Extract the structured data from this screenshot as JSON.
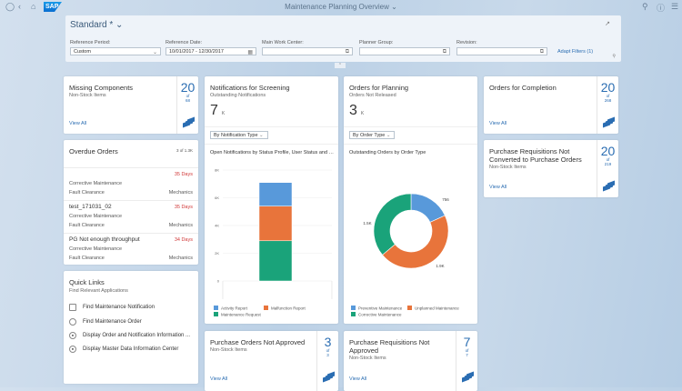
{
  "shell": {
    "title": "Maintenance Planning Overview",
    "logo": "SAP",
    "icons": [
      "user-icon",
      "back-icon",
      "home-icon",
      "search-icon",
      "help-icon",
      "menu-icon"
    ]
  },
  "filter": {
    "variant": "Standard *",
    "fields": [
      {
        "label": "Reference Period:",
        "value": "Custom"
      },
      {
        "label": "Reference Date:",
        "value": "10/01/2017 - 12/30/2017"
      },
      {
        "label": "Main Work Center:",
        "value": ""
      },
      {
        "label": "Planner Group:",
        "value": ""
      },
      {
        "label": "Revision:",
        "value": ""
      }
    ],
    "adapt": "Adapt Filters (1)"
  },
  "cards": {
    "missing": {
      "title": "Missing Components",
      "sub": "Non-Stock Items",
      "count": "20",
      "of": "of",
      "total": "68",
      "link": "View All"
    },
    "overdue": {
      "title": "Overdue Orders",
      "counter": "3 of 1.3K",
      "rows": [
        {
          "title": "",
          "days": "35 Days",
          "type": "Corrective Maintenance",
          "activity": "Fault Clearance",
          "group": "Mechanics"
        },
        {
          "title": "test_171031_02",
          "days": "35 Days",
          "type": "Corrective Maintenance",
          "activity": "Fault Clearance",
          "group": "Mechanics"
        },
        {
          "title": "PG Not enough throughput",
          "days": "34 Days",
          "type": "Corrective Maintenance",
          "activity": "Fault Clearance",
          "group": "Mechanics"
        }
      ]
    },
    "quick": {
      "title": "Quick Links",
      "sub": "Find Relevant Applications",
      "links": [
        "Find Maintenance Notification",
        "Find Maintenance Order",
        "Display Order and Notification Information ...",
        "Display Master Data Information Center"
      ]
    },
    "screening": {
      "title": "Notifications for Screening",
      "sub": "Outstanding Notifications",
      "kpi": "7",
      "unit": "K",
      "select": "By Notification Type",
      "chart_title": "Open Notifications by Status Profile, User Status and No..."
    },
    "planning": {
      "title": "Orders for Planning",
      "sub": "Orders Not Released",
      "kpi": "3",
      "unit": "K",
      "select": "By Order Type",
      "chart_title": "Outstanding Orders by Order Type"
    },
    "completion": {
      "title": "Orders for Completion",
      "count": "20",
      "of": "of",
      "total": "268",
      "link": "View All"
    },
    "prnc": {
      "title": "Purchase Requisitions Not Converted to Purchase Orders",
      "sub": "Non-Stock Items",
      "count": "20",
      "of": "of",
      "total": "219",
      "link": "View All"
    },
    "pona": {
      "title": "Purchase Orders Not Approved",
      "sub": "Non-Stock Items",
      "count": "3",
      "of": "of",
      "total": "3",
      "link": "View All"
    },
    "prna": {
      "title": "Purchase Requisitions Not Approved",
      "sub": "Non-Stock Items",
      "count": "7",
      "of": "of",
      "total": "7",
      "link": "View All"
    }
  },
  "chart_data": [
    {
      "type": "bar",
      "stacked": true,
      "categories": [
        ""
      ],
      "series": [
        {
          "name": "Maintenance Request",
          "values": [
            2900
          ],
          "color": "#1aa37a"
        },
        {
          "name": "Malfunction Report",
          "values": [
            2500
          ],
          "color": "#e8743b"
        },
        {
          "name": "Activity Report",
          "values": [
            1700
          ],
          "color": "#5899da"
        }
      ],
      "ylim": [
        0,
        8000
      ],
      "yticks": [
        "0",
        "2K",
        "4K",
        "6K",
        "8K"
      ],
      "grid": true,
      "legend": "bottom"
    },
    {
      "type": "pie",
      "donut": true,
      "slices": [
        {
          "name": "Preventive Maintenance",
          "label": "756",
          "value": 756,
          "color": "#5899da"
        },
        {
          "name": "Unplanned Maintenance",
          "label": "1.9K",
          "value": 1900,
          "color": "#e8743b"
        },
        {
          "name": "Corrective Maintenance",
          "label": "1.5K",
          "value": 1500,
          "color": "#1aa37a"
        }
      ],
      "legend": "bottom"
    }
  ]
}
